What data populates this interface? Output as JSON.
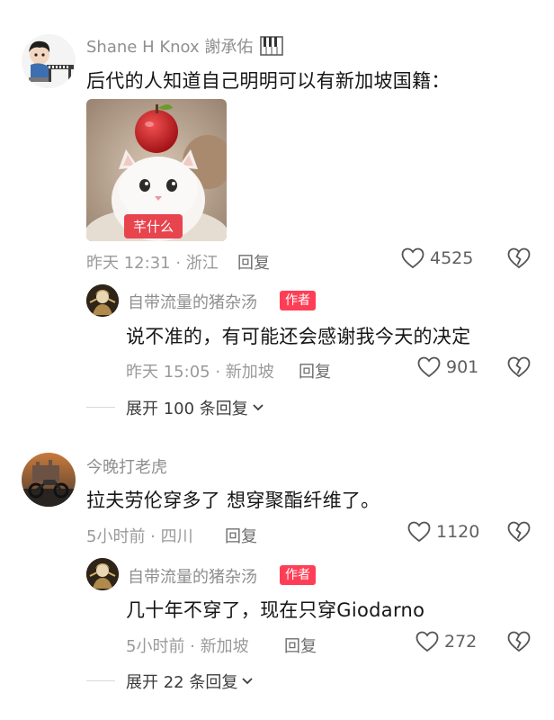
{
  "comments": [
    {
      "username": "Shane H Knox 謝承佑",
      "text": "后代的人知道自己明明可以有新加坡国籍：",
      "sticker_caption": "芊什么",
      "meta": "昨天 12:31 · 浙江",
      "reply_label": "回复",
      "likes": "4525",
      "replies": [
        {
          "username": "自带流量的猪杂汤",
          "badge": "作者",
          "text": "说不准的，有可能还会感谢我今天的决定",
          "meta": "昨天 15:05 · 新加坡",
          "reply_label": "回复",
          "likes": "901"
        }
      ],
      "expand_label": "展开 100 条回复"
    },
    {
      "username": "今晚打老虎",
      "text": "拉夫劳伦穿多了 想穿聚酯纤维了。",
      "meta": "5小时前 · 四川",
      "reply_label": "回复",
      "likes": "1120",
      "replies": [
        {
          "username": "自带流量的猪杂汤",
          "badge": "作者",
          "text": "几十年不穿了，现在只穿Giodarno",
          "meta": "5小时前 · 新加坡",
          "reply_label": "回复",
          "likes": "272"
        }
      ],
      "expand_label": "展开 22 条回复"
    }
  ],
  "icons": {
    "like": "heart-outline-icon",
    "dislike": "broken-heart-icon",
    "expand": "chevron-down-icon",
    "piano": "piano-emoji-icon"
  },
  "colors": {
    "badge": "#fe3e56",
    "sticker_label": "#e8444e",
    "muted_text": "#9a9a9a"
  }
}
